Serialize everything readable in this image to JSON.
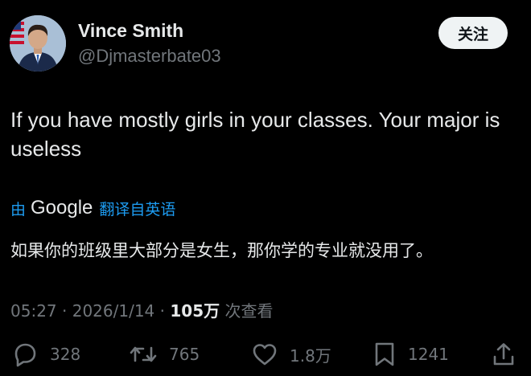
{
  "author": {
    "display_name": "Vince Smith",
    "handle": "@Djmasterbate03"
  },
  "follow_button": {
    "label": "关注"
  },
  "tweet": {
    "text": "If you have mostly girls in your classes. Your major is useless"
  },
  "translation": {
    "prefix": "由",
    "provider": "Google",
    "suffix": "翻译自英语",
    "text": "如果你的班级里大部分是女生，那你学的专业就没用了。"
  },
  "meta": {
    "time": "05:27",
    "separator1": "·",
    "date": "2026/1/14",
    "separator2": "·",
    "views_count": "105万",
    "views_label": "次查看"
  },
  "actions": {
    "reply_count": "328",
    "retweet_count": "765",
    "like_count": "1.8万",
    "bookmark_count": "1241"
  },
  "colors": {
    "background": "#000000",
    "primary_text": "#e7e9ea",
    "secondary_text": "#71767b",
    "link": "#1d9bf0",
    "follow_button_bg": "#eff3f4"
  },
  "icons": {
    "reply": "reply-icon",
    "retweet": "retweet-icon",
    "like": "heart-icon",
    "bookmark": "bookmark-icon",
    "share": "share-icon"
  }
}
